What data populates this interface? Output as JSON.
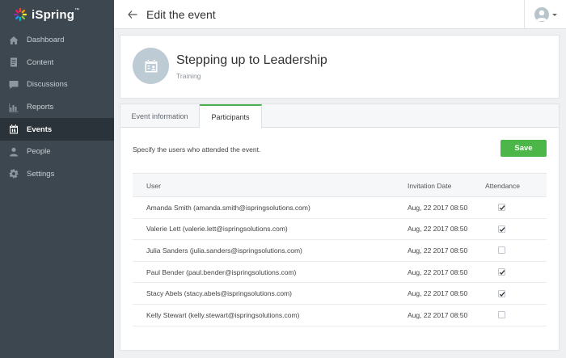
{
  "brand": {
    "name": "iSpring",
    "mark": "™"
  },
  "sidebar": {
    "items": [
      {
        "label": "Dashboard",
        "icon": "home-icon",
        "active": false
      },
      {
        "label": "Content",
        "icon": "document-icon",
        "active": false
      },
      {
        "label": "Discussions",
        "icon": "chat-icon",
        "active": false
      },
      {
        "label": "Reports",
        "icon": "bar-chart-icon",
        "active": false
      },
      {
        "label": "Events",
        "icon": "calendar-icon",
        "active": true
      },
      {
        "label": "People",
        "icon": "person-icon",
        "active": false
      },
      {
        "label": "Settings",
        "icon": "gear-icon",
        "active": false
      }
    ]
  },
  "header": {
    "title": "Edit the event"
  },
  "event": {
    "name": "Stepping up to Leadership",
    "type": "Training"
  },
  "tabs": [
    {
      "label": "Event information",
      "active": false
    },
    {
      "label": "Participants",
      "active": true
    }
  ],
  "participants": {
    "instruction": "Specify the users who attended the event.",
    "save_label": "Save",
    "columns": {
      "user": "User",
      "date": "Invitation Date",
      "attendance": "Attendance"
    },
    "rows": [
      {
        "user": "Amanda Smith (amanda.smith@ispringsolutions.com)",
        "date": "Aug, 22 2017 08:50",
        "attended": true
      },
      {
        "user": "Valerie Lett (valerie.lett@ispringsolutions.com)",
        "date": "Aug, 22 2017 08:50",
        "attended": true
      },
      {
        "user": "Julia Sanders (julia.sanders@ispringsolutions.com)",
        "date": "Aug, 22 2017 08:50",
        "attended": false
      },
      {
        "user": "Paul Bender (paul.bender@ispringsolutions.com)",
        "date": "Aug, 22 2017 08:50",
        "attended": true
      },
      {
        "user": "Stacy Abels (stacy.abels@ispringsolutions.com)",
        "date": "Aug, 22 2017 08:50",
        "attended": true
      },
      {
        "user": "Kelly Stewart (kelly.stewart@ispringsolutions.com)",
        "date": "Aug, 22 2017 08:50",
        "attended": false
      }
    ]
  },
  "colors": {
    "sidebar": "#3c4750",
    "sidebar_active": "#2a333a",
    "accent_green": "#4cb748"
  }
}
